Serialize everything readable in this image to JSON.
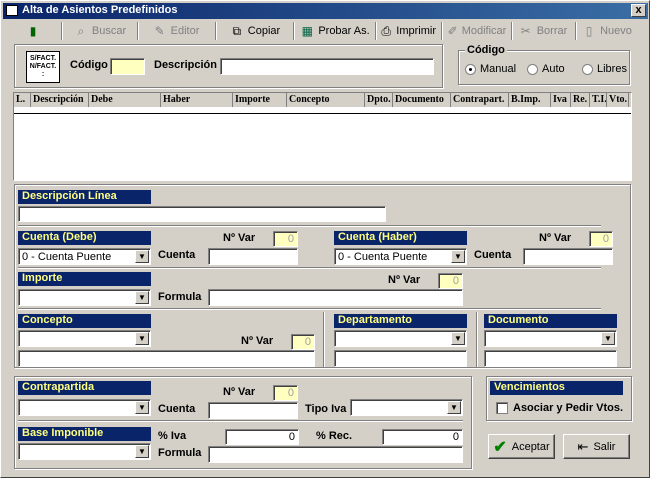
{
  "window": {
    "title": "Alta de Asientos Predefinidos",
    "close": "x"
  },
  "toolbar": {
    "buscar": "Buscar",
    "editor": "Editor",
    "copiar": "Copiar",
    "probar": "Probar As.",
    "imprimir": "Imprimir",
    "modificar": "Modificar",
    "borrar": "Borrar",
    "nuevo": "Nuevo"
  },
  "header": {
    "badge": "S/FACT.\nN/FACT.\n:",
    "codigo_label": "Código",
    "codigo_value": "",
    "descripcion_label": "Descripción",
    "descripcion_value": "",
    "codigo_group": "Código",
    "radio_manual": "Manual",
    "radio_auto": "Auto",
    "radio_libres": "Libres",
    "selected_radio": "manual"
  },
  "grid": {
    "columns": [
      "L.",
      "Descripción",
      "Debe",
      "Haber",
      "Importe",
      "Concepto",
      "Dpto.",
      "Documento",
      "Contrapart.",
      "B.Imp.",
      "Iva",
      "Re.",
      "T.I.",
      "Vto."
    ]
  },
  "linea": {
    "descripcion_label": "Descripción Línea",
    "descripcion_value": "",
    "cuenta_debe_label": "Cuenta (Debe)",
    "cuenta_debe_combo": "0 - Cuenta Puente",
    "cuenta_label": "Cuenta",
    "nvar_label": "Nº Var",
    "nvar_debe": "0",
    "cuenta_haber_label": "Cuenta (Haber)",
    "cuenta_haber_combo": "0 - Cuenta Puente",
    "nvar_haber": "0",
    "importe_label": "Importe",
    "nvar_importe": "0",
    "formula_label": "Formula",
    "concepto_label": "Concepto",
    "nvar_concepto": "0",
    "departamento_label": "Departamento",
    "documento_label": "Documento"
  },
  "bottom": {
    "contrapartida_label": "Contrapartida",
    "nvar_label": "Nº Var",
    "nvar_contra": "0",
    "cuenta_label": "Cuenta",
    "tipo_iva_label": "Tipo Iva",
    "base_label": "Base Imponible",
    "iva_label": "% Iva",
    "iva_value": "0",
    "rec_label": "% Rec.",
    "rec_value": "0",
    "formula_label": "Formula"
  },
  "vencimientos": {
    "title": "Vencimientos",
    "asociar": "Asociar y Pedir Vtos."
  },
  "actions": {
    "aceptar": "Aceptar",
    "salir": "Salir"
  }
}
